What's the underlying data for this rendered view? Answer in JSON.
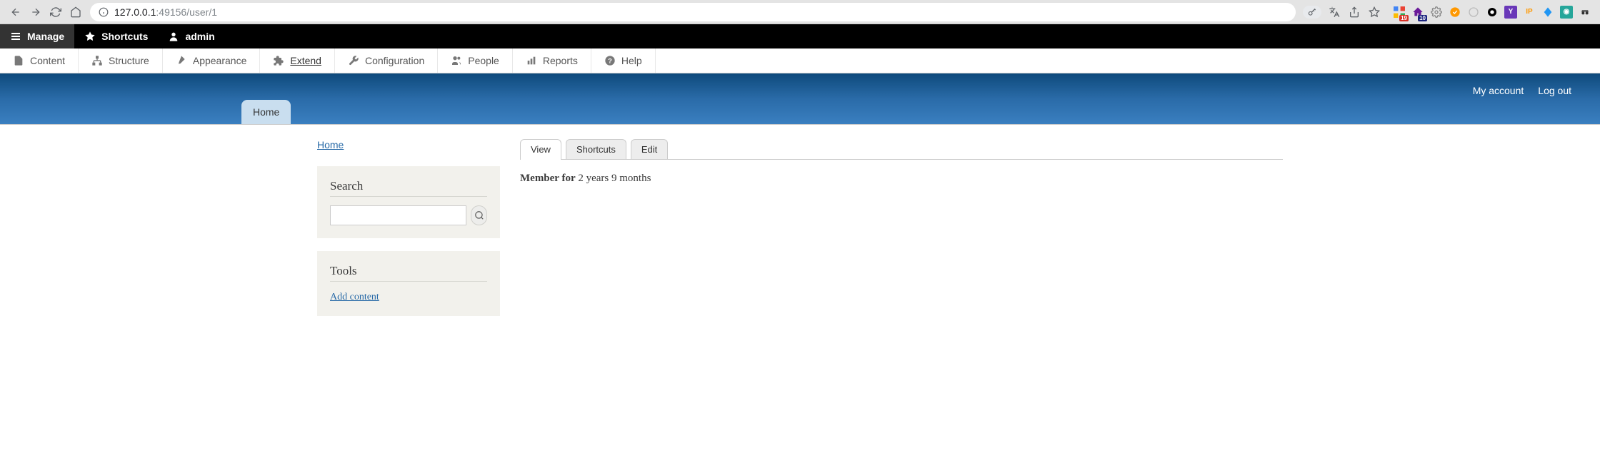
{
  "browser": {
    "url_host": "127.0.0.1",
    "url_path": ":49156/user/1"
  },
  "top_toolbar": {
    "manage": "Manage",
    "shortcuts": "Shortcuts",
    "user": "admin"
  },
  "admin_menu": {
    "content": "Content",
    "structure": "Structure",
    "appearance": "Appearance",
    "extend": "Extend",
    "configuration": "Configuration",
    "people": "People",
    "reports": "Reports",
    "help": "Help"
  },
  "user_links": {
    "my_account": "My account",
    "log_out": "Log out"
  },
  "nav": {
    "home_tab": "Home",
    "breadcrumb": "Home"
  },
  "sidebar": {
    "search_heading": "Search",
    "tools_heading": "Tools",
    "add_content": "Add content"
  },
  "tabs": {
    "view": "View",
    "shortcuts": "Shortcuts",
    "edit": "Edit"
  },
  "profile": {
    "member_for_label": "Member for",
    "member_for_value": "2 years 9 months"
  },
  "ext_badges": {
    "red": "19",
    "purple": "10"
  }
}
